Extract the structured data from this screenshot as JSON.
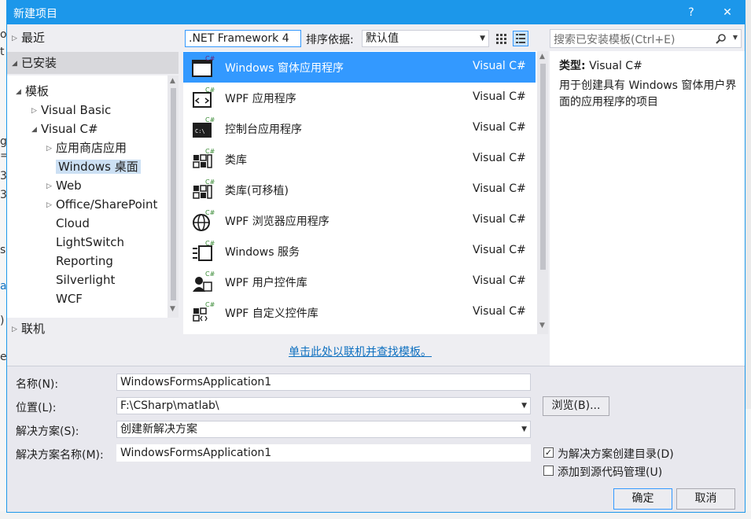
{
  "background": {
    "left_fragments": [
      "o",
      "t",
      "g",
      "=",
      "3",
      "3",
      "s",
      "a",
      ")",
      "e"
    ]
  },
  "dialog": {
    "title": "新建项目",
    "help_button": "?",
    "close_button": "✕",
    "accent_color": "#1c97ea"
  },
  "tree": {
    "recent": "最近",
    "installed": "已安装",
    "templates": "模板",
    "visual_basic": "Visual Basic",
    "visual_csharp": "Visual C#",
    "children": [
      "应用商店应用",
      "Windows 桌面",
      "Web",
      "Office/SharePoint",
      "Cloud",
      "LightSwitch",
      "Reporting",
      "Silverlight",
      "WCF"
    ],
    "online": "联机"
  },
  "toolbar": {
    "framework": ".NET Framework 4",
    "sort_label": "排序依据:",
    "sort_value": "默认值"
  },
  "templates": [
    {
      "name": "Windows 窗体应用程序",
      "lang": "Visual C#"
    },
    {
      "name": "WPF 应用程序",
      "lang": "Visual C#"
    },
    {
      "name": "控制台应用程序",
      "lang": "Visual C#"
    },
    {
      "name": "类库",
      "lang": "Visual C#"
    },
    {
      "name": "类库(可移植)",
      "lang": "Visual C#"
    },
    {
      "name": "WPF 浏览器应用程序",
      "lang": "Visual C#"
    },
    {
      "name": "Windows 服务",
      "lang": "Visual C#"
    },
    {
      "name": "WPF 用户控件库",
      "lang": "Visual C#"
    },
    {
      "name": "WPF 自定义控件库",
      "lang": "Visual C#"
    }
  ],
  "online_link": "单击此处以联机并查找模板。",
  "search": {
    "placeholder": "搜索已安装模板(Ctrl+E)"
  },
  "description": {
    "type_label": "类型:",
    "type_value": "Visual C#",
    "text": "用于创建具有 Windows 窗体用户界面的应用程序的项目"
  },
  "form": {
    "name_label": "名称(N):",
    "name_value": "WindowsFormsApplication1",
    "location_label": "位置(L):",
    "location_value": "F:\\CSharp\\matlab\\",
    "browse": "浏览(B)...",
    "solution_label": "解决方案(S):",
    "solution_value": "创建新解决方案",
    "solution_name_label": "解决方案名称(M):",
    "solution_name_value": "WindowsFormsApplication1",
    "create_dir": "为解决方案创建目录(D)",
    "create_dir_checked": true,
    "add_scc": "添加到源代码管理(U)",
    "add_scc_checked": false,
    "ok": "确定",
    "cancel": "取消"
  }
}
